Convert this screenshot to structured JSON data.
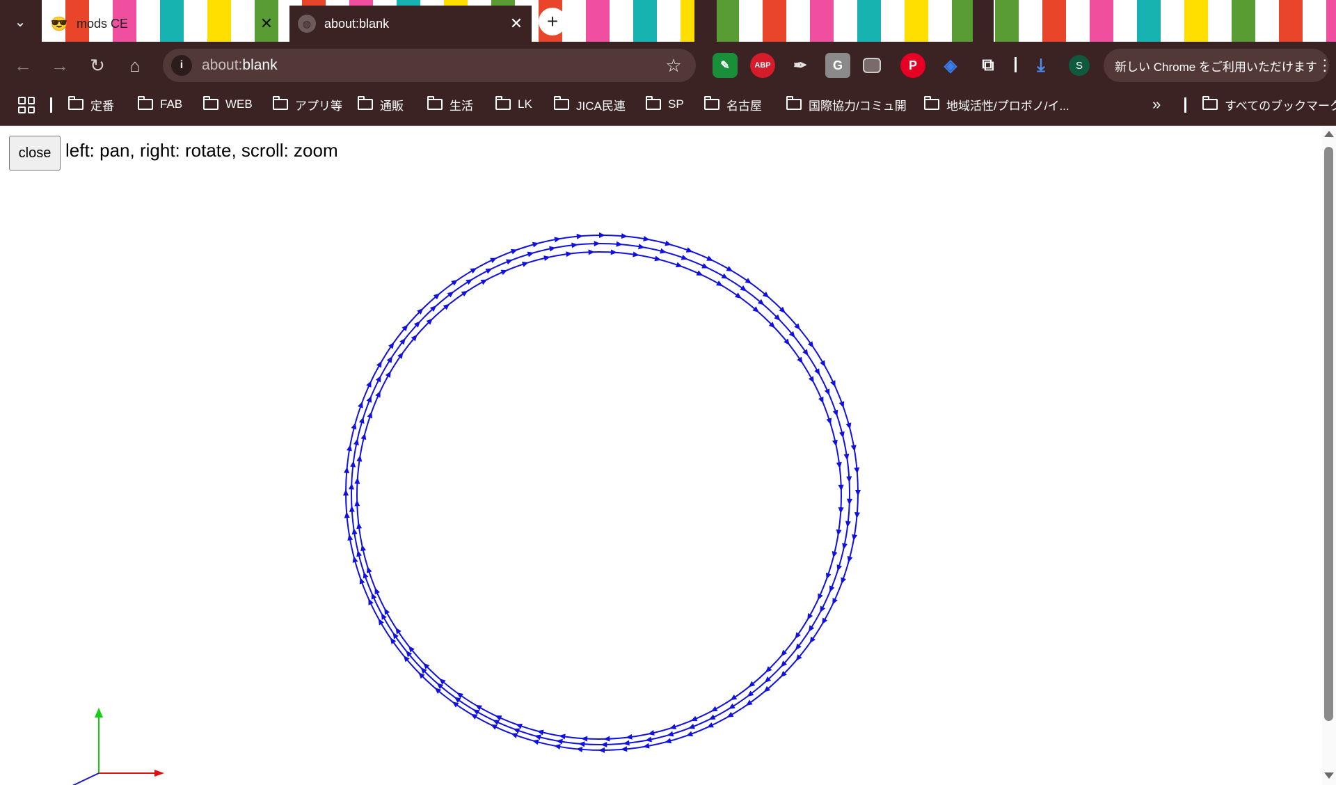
{
  "window": {
    "tabs": [
      {
        "label": "mods CE",
        "favicon": "sunglasses-emoji-icon",
        "active": false
      },
      {
        "label": "about:blank",
        "favicon": "globe-icon",
        "active": true
      }
    ],
    "tab_close_glyph": "✕",
    "new_tab_glyph": "+",
    "controls": {
      "minimize": "—",
      "restore": "❐",
      "close": "✕"
    }
  },
  "toolbar": {
    "url_prefix": "about:",
    "url_host": "blank",
    "extensions": [
      "evernote-icon",
      "adblock-plus-icon",
      "color-picker-icon",
      "google-translate-icon",
      "tab-snapshot-icon",
      "pinterest-icon",
      "tag-assistant-icon",
      "extensions-puzzle-icon"
    ],
    "adblock_label": "ABP",
    "profile_initial": "S",
    "chrome_notice": "新しい Chrome をご利用いただけます"
  },
  "bookmarks": {
    "items": [
      "定番",
      "FAB",
      "WEB",
      "アプリ等",
      "通販",
      "生活",
      "LK",
      "JICA民連",
      "SP",
      "名古屋",
      "国際協力/コミュ開",
      "地域活性/プロボノ/イ..."
    ],
    "overflow": "»",
    "all_bookmarks": "すべてのブックマーク"
  },
  "page": {
    "close_label": "close",
    "help_text": "left: pan, right: rotate, scroll: zoom"
  },
  "colors": {
    "chrome_bg": "#3b2323",
    "path_color": "#1010e0",
    "axis_x": "#e01010",
    "axis_y": "#10d010",
    "axis_z": "#2020c0"
  }
}
